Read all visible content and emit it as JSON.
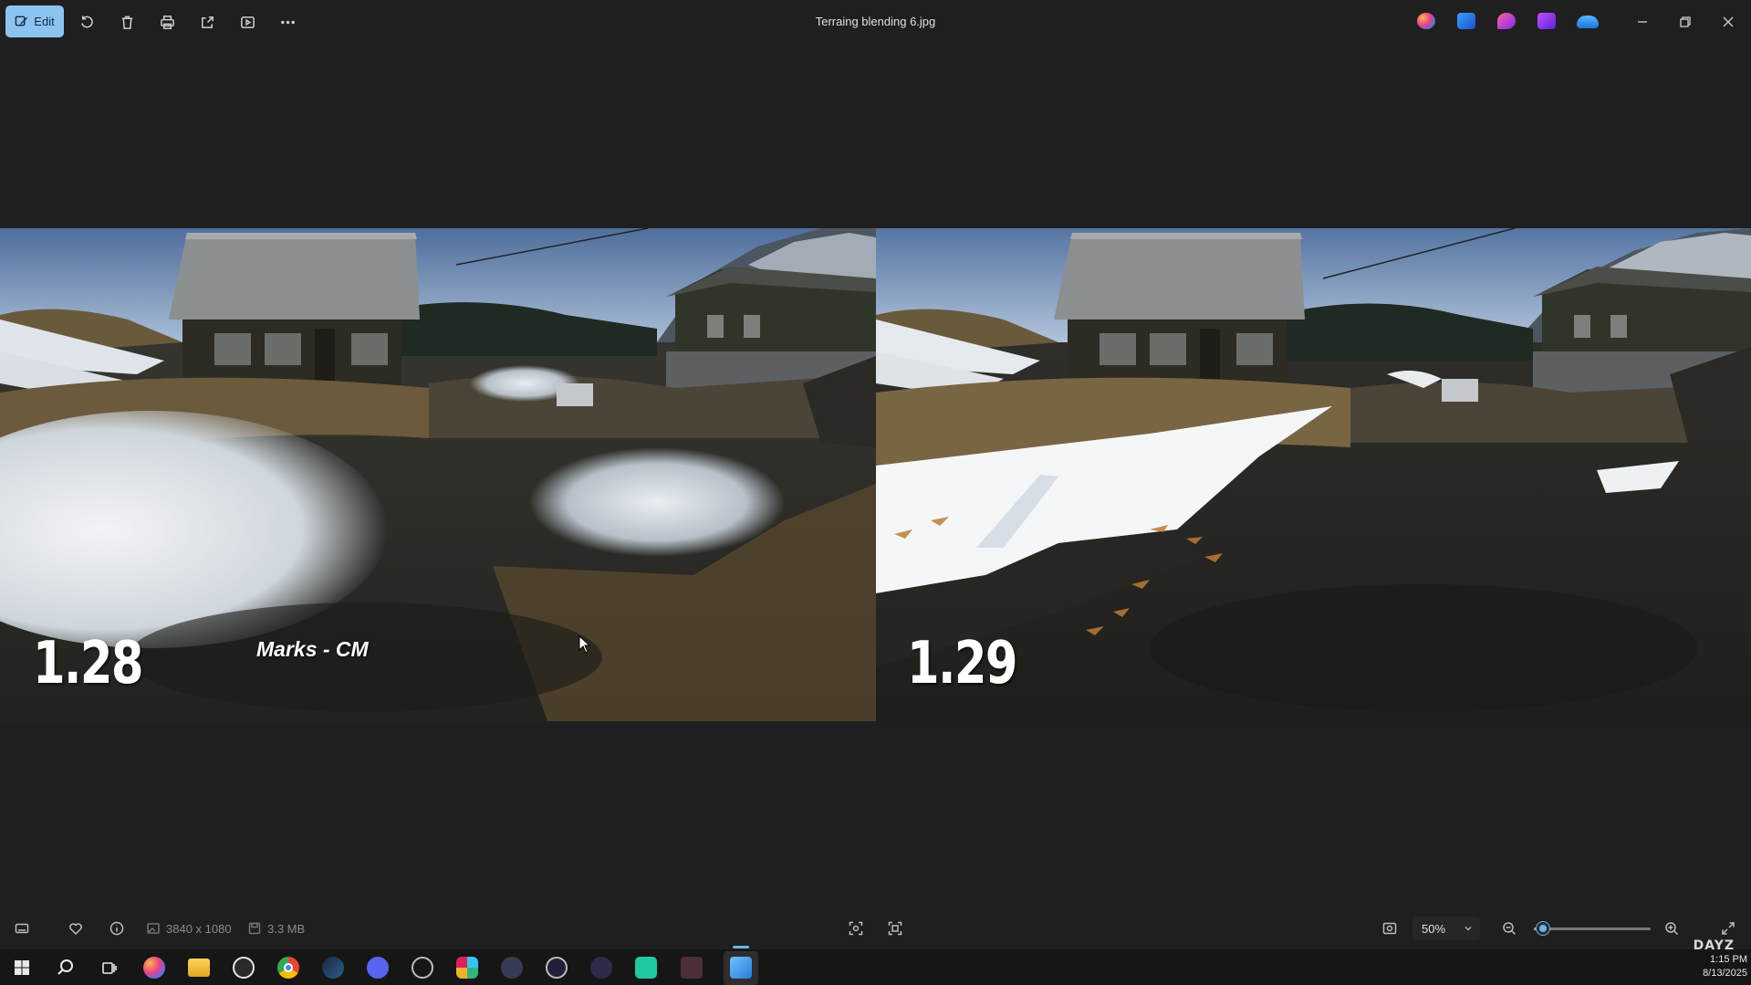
{
  "toolbar": {
    "edit_label": "Edit",
    "tools": [
      "rotate-icon",
      "delete-icon",
      "print-icon",
      "share-icon",
      "slideshow-icon",
      "more-icon"
    ]
  },
  "window": {
    "title": "Terraing blending 6.jpg",
    "app_icons": [
      "copilot-icon",
      "designer-icon",
      "clipchamp-icon",
      "create-icon",
      "onedrive-icon"
    ],
    "controls": [
      "minimize-icon",
      "restore-icon",
      "close-icon"
    ]
  },
  "image": {
    "left_version": "1.28",
    "right_version": "1.29",
    "caption": "Marks - CM"
  },
  "statusbar": {
    "dimensions": "3840 x 1080",
    "file_size": "3.3 MB",
    "zoom_value": "50%",
    "zoom_level": 0.08
  },
  "taskbar": {
    "icons": [
      "windows-start-icon",
      "search-icon",
      "task-view-icon",
      "copilot-icon",
      "file-explorer-icon",
      "obs-icon",
      "chrome-icon",
      "steam-icon",
      "discord-icon",
      "app-icon-8",
      "slack-icon",
      "app-icon-10",
      "media-player-icon",
      "app-icon-12",
      "app-icon-13",
      "app-icon-14",
      "photos-icon"
    ],
    "time": "1:15 PM",
    "date": "8/13/2025",
    "overlay_brand": "DAYZ"
  },
  "colors": {
    "accent": "#8cc4f0",
    "background": "#1f1f1f",
    "taskbar": "#161616"
  }
}
